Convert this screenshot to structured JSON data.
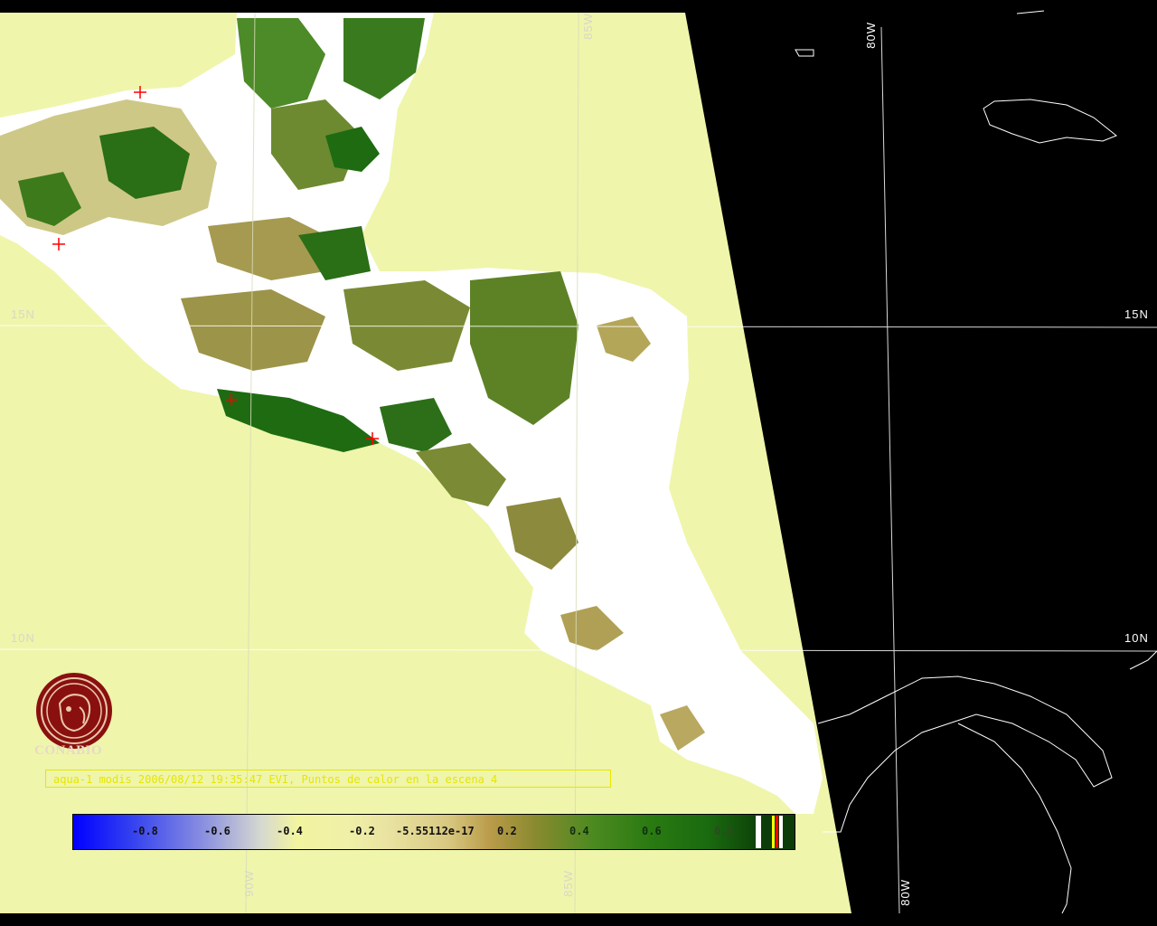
{
  "colors": {
    "ocean_background": "#eff5ab",
    "outside_scene": "#000000",
    "land_cloud": "#ffffff",
    "vegetation_dark": "#1e6b12",
    "vegetation_mid": "#8a8a30",
    "graticule": "#ffffff",
    "hotspot_marker": "#ff0000",
    "caption_text": "#e6e600",
    "logo_red": "#8a1010"
  },
  "graticule_labels": {
    "lat_15n_left": "15N",
    "lat_15n_right": "15N",
    "lat_10n_left": "10N",
    "lat_10n_right": "10N",
    "lon_85w_top": "85W",
    "lon_80w_top": "80W",
    "lon_90w_bottom": "90W",
    "lon_85w_bottom": "85W",
    "lon_80w_bottom": "80W"
  },
  "logo": {
    "name": "CONABIO"
  },
  "caption": "aqua-1 modis 2006/08/12 19:35:47 EVI, Puntos de calor en la escena 4",
  "colorbar": {
    "ticks": [
      "-0.8",
      "-0.6",
      "-0.4",
      "-0.2",
      "-5.55112e-17",
      "0.2",
      "0.4",
      "0.6",
      "0.8"
    ],
    "range": [
      -1.0,
      1.0
    ],
    "special_classes": [
      "cloud/no-data (white)",
      "hotspot (red/yellow)"
    ]
  },
  "hotspots_count": 4
}
